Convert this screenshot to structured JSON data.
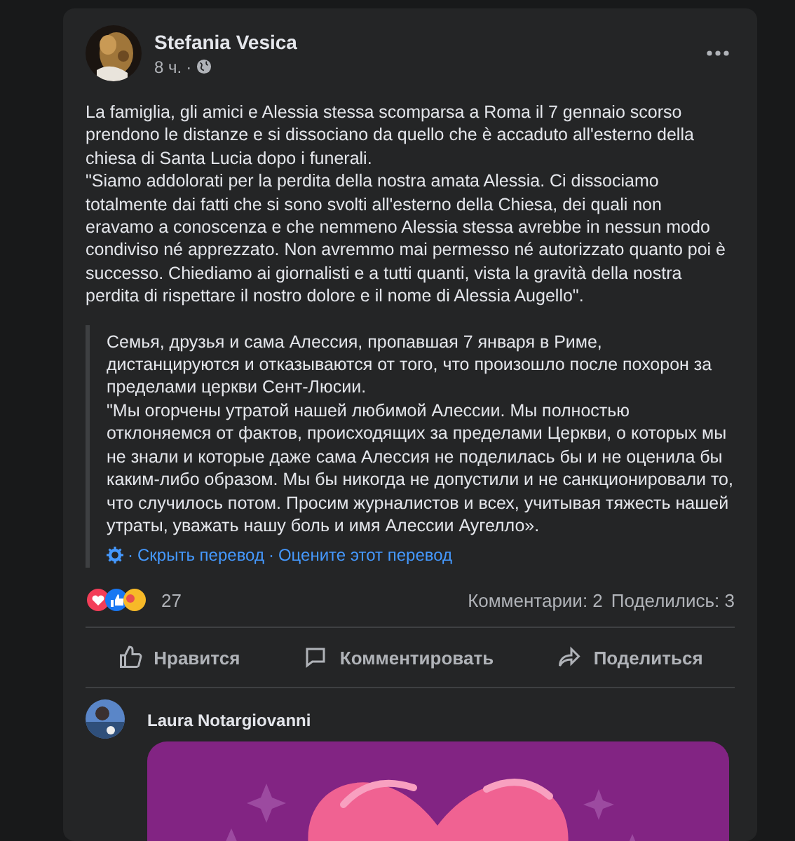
{
  "post": {
    "author": "Stefania Vesica",
    "time": "8 ч.",
    "separator": "·",
    "paragraphs": [
      "La famiglia, gli amici e Alessia stessa scomparsa a Roma il 7 gennaio scorso prendono le distanze e si dissociano da quello che è accaduto all'esterno della chiesa di Santa Lucia dopo i funerali.",
      "\"Siamo addolorati per la perdita della nostra amata Alessia. Ci dissociamo totalmente dai fatti che si sono svolti all'esterno della Chiesa, dei quali non eravamo a conoscenza e che nemmeno Alessia stessa avrebbe in nessun modo condiviso né apprezzato. Non avremmo mai permesso né autorizzato quanto poi è successo. Chiediamo ai giornalisti e a tutti quanti, vista la gravità della nostra perdita di rispettare il nostro dolore e il nome di Alessia Augello\"."
    ],
    "translation": {
      "paragraphs": [
        "Семья, друзья и сама Алессия, пропавшая 7 января в Риме, дистанцируются и отказываются от того, что произошло после похорон за пределами церкви Сент-Люсии.",
        "\"Мы огорчены утратой нашей любимой Алессии. Мы полностью отклоняемся от фактов, происходящих за пределами Церкви, о которых мы не знали и которые даже сама Алессия не поделилась бы и не оценила бы каким-либо образом. Мы бы никогда не допустили и не санкционировали то, что случилось потом. Просим журналистов и всех, учитывая тяжесть нашей утраты, уважать нашу боль и имя Алессии Аугелло»."
      ],
      "links": [
        {
          "sep": "·",
          "label": "Скрыть перевод"
        },
        {
          "sep": "·",
          "label": "Оцените этот перевод"
        }
      ]
    },
    "reactions_count": "27",
    "comments_count": "Комментарии: 2",
    "shares_count": "Поделились: 3",
    "actions": [
      {
        "kind": "like",
        "label": "Нравится"
      },
      {
        "kind": "comment",
        "label": "Комментировать"
      },
      {
        "kind": "share",
        "label": "Поделиться"
      }
    ]
  },
  "comment": {
    "author": "Laura Notargiovanni",
    "attachment": {
      "kind": "sticker"
    }
  }
}
